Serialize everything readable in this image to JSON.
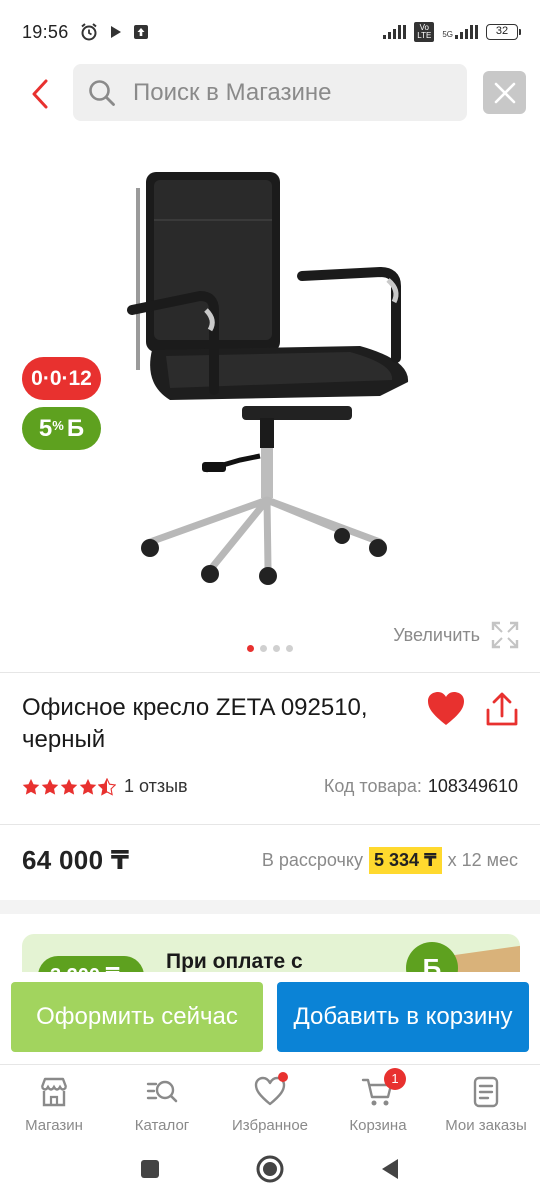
{
  "status_bar": {
    "time": "19:56",
    "battery": "32",
    "network": "5G",
    "volte": "Vo LTE"
  },
  "search": {
    "placeholder": "Поиск в Магазине"
  },
  "product": {
    "image_alt": "Офисное кресло",
    "badge_installment": "0·0·12",
    "badge_bonus_percent": "5",
    "badge_bonus_currency": "Б",
    "zoom_label": "Увеличить",
    "gallery_count": 4,
    "gallery_active": 1,
    "title": "Офисное кресло ZETA 092510, черный",
    "rating": 4.5,
    "reviews": "1 отзыв",
    "sku_label": "Код товара:",
    "sku_value": "108349610",
    "price": "64 000 ₸",
    "installment_prefix": "В рассрочку",
    "installment_monthly": "5 334 ₸",
    "installment_suffix": "x 12 мес"
  },
  "promo": {
    "amount": "3 200 ₸",
    "text": "При оплате с",
    "coin": "Б"
  },
  "actions": {
    "buy_now": "Оформить сейчас",
    "add_to_cart": "Добавить в корзину"
  },
  "bottom_nav": [
    {
      "label": "Магазин",
      "icon": "shop-icon"
    },
    {
      "label": "Каталог",
      "icon": "catalog-search-icon"
    },
    {
      "label": "Избранное",
      "icon": "heart-icon"
    },
    {
      "label": "Корзина",
      "icon": "cart-icon",
      "badge": "1"
    },
    {
      "label": "Мои заказы",
      "icon": "orders-icon"
    }
  ],
  "colors": {
    "accent_red": "#e8312f",
    "bonus_green": "#5ea11f",
    "buy_now_green": "#a2d45e",
    "cart_blue": "#0b83d6",
    "installment_yellow": "#ffd92e"
  }
}
